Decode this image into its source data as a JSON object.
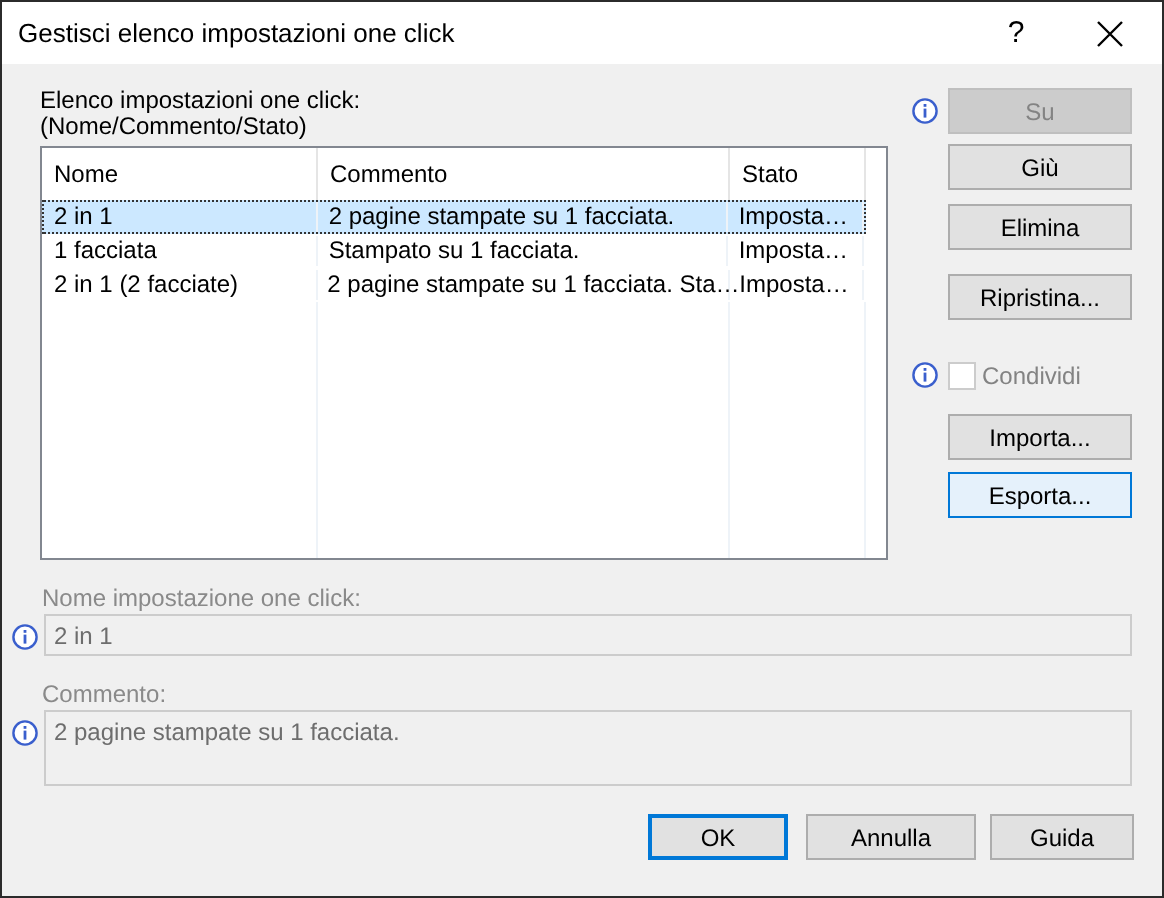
{
  "window": {
    "title": "Gestisci elenco impostazioni one click",
    "help": "?"
  },
  "list": {
    "label": [
      "Elenco impostazioni one click:",
      "(Nome/Commento/Stato)"
    ],
    "columns": [
      "Nome",
      "Commento",
      "Stato"
    ],
    "rows": [
      {
        "cells": [
          "2 in 1",
          "2 pagine stampate su 1 facciata.",
          "Imposta…"
        ],
        "selected": true
      },
      {
        "cells": [
          "1 facciata",
          "Stampato su 1 facciata.",
          "Imposta…"
        ],
        "selected": false
      },
      {
        "cells": [
          "2 in 1 (2 facciate)",
          "2 pagine stampate su 1 facciata. Sta…",
          "Imposta…"
        ],
        "selected": false
      }
    ]
  },
  "side": [
    {
      "kind": "button",
      "label": "Su",
      "disabled": true,
      "info": true,
      "focused": false
    },
    {
      "kind": "button",
      "label": "Giù",
      "disabled": false,
      "info": false,
      "focused": false
    },
    {
      "kind": "button",
      "label": "Elimina",
      "disabled": false,
      "info": false,
      "focused": false
    },
    {
      "kind": "button",
      "label": "Ripristina...",
      "disabled": false,
      "info": false,
      "focused": false
    },
    {
      "kind": "checkbox",
      "label": "Condividi",
      "disabled": true,
      "info": true,
      "checked": false
    },
    {
      "kind": "button",
      "label": "Importa...",
      "disabled": false,
      "info": false,
      "focused": false
    },
    {
      "kind": "button",
      "label": "Esporta...",
      "disabled": false,
      "info": false,
      "focused": true
    }
  ],
  "fields": [
    {
      "kind": "line",
      "label": "Nome impostazione one click:",
      "value": "2 in 1",
      "disabled": true
    },
    {
      "kind": "area",
      "label": "Commento:",
      "value": "2 pagine stampate su 1 facciata.",
      "disabled": true
    }
  ],
  "buttons": [
    {
      "label": "OK",
      "default": true
    },
    {
      "label": "Annulla",
      "default": false
    },
    {
      "label": "Guida",
      "default": false
    }
  ]
}
